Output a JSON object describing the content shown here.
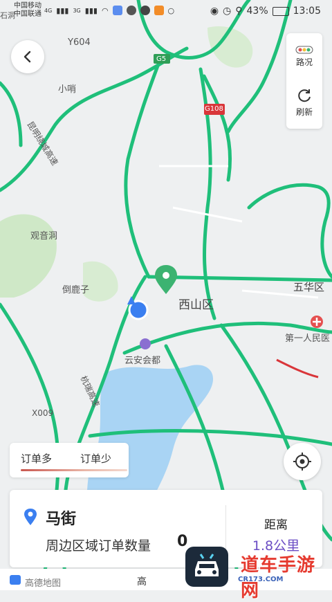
{
  "status_bar": {
    "carrier_1": "中国移动",
    "carrier_2": "中国联通",
    "net_1": "4G",
    "net_2": "3G",
    "battery": "43%",
    "time": "13:05"
  },
  "map": {
    "labels": {
      "y604": "Y604",
      "g5": "G5",
      "g108": "G108",
      "xiaoshao": "小哨",
      "kunming_expressway": "昆明绕城高速",
      "guanyindong": "观音洞",
      "daoluzi": "倒鹿子",
      "xishan_district": "西山区",
      "wuhua_district": "五华区",
      "first_hospital": "第一人民医",
      "yunan_huidu": "云安会都",
      "hangrui_expressway": "杭瑞高速",
      "x009": "X009",
      "left_edge": "石洞"
    }
  },
  "side_panel": {
    "traffic_label": "路况",
    "refresh_label": "刷新"
  },
  "legend": {
    "more_orders": "订单多",
    "fewer_orders": "订单少"
  },
  "location_card": {
    "name": "马街",
    "description": "周边区域订单数量",
    "order_count": "0",
    "distance_label": "距离",
    "distance_value": "1.8公里"
  },
  "footer": {
    "amap_logo": "高德地图",
    "road_marker": "高"
  },
  "watermark": {
    "text": "道车手游网",
    "url": "CR173.COM"
  },
  "colors": {
    "road_green": "#1fbf7a",
    "water": "#a9d4f4",
    "park": "#cfe8c7",
    "accent_purple": "#6a4cc4",
    "marker_green": "#3cb371",
    "current_location": "#3b7ff0"
  }
}
